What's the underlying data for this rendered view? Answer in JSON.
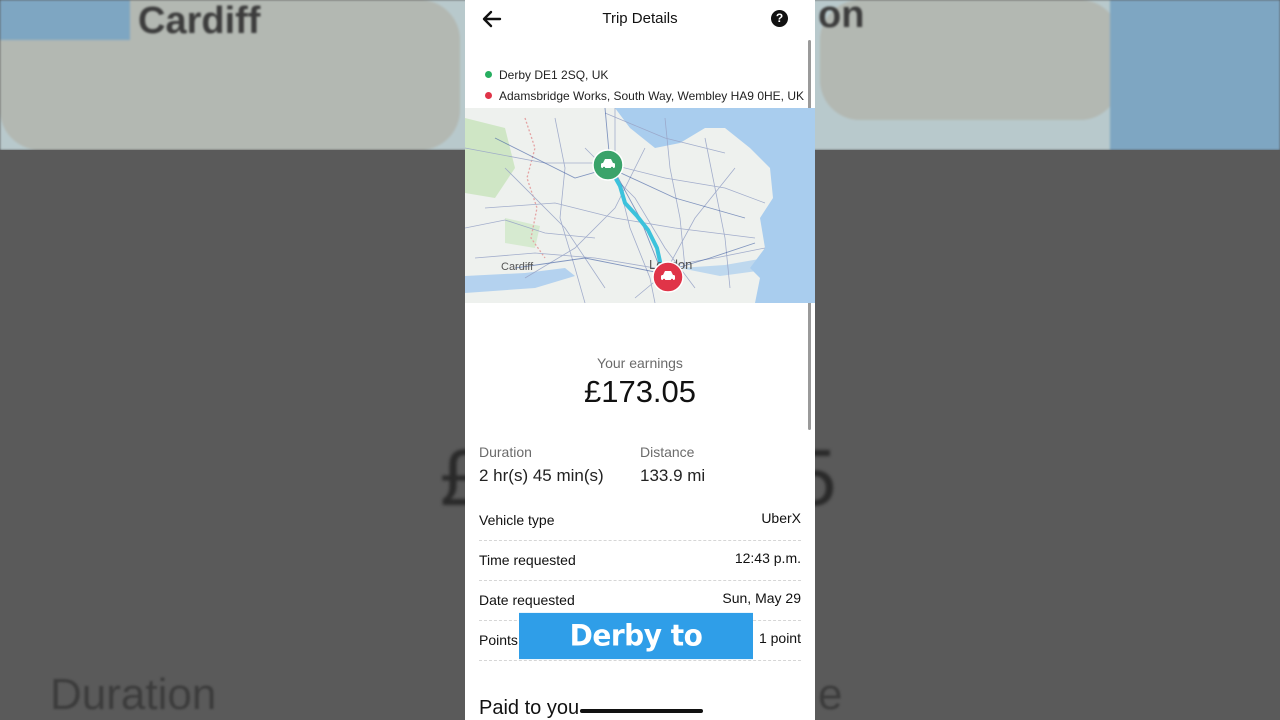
{
  "header": {
    "title": "Trip Details",
    "back_icon": "arrow-left-icon",
    "help_icon": "question-circle-icon",
    "help_glyph": "?"
  },
  "route": {
    "pickup": "Derby DE1 2SQ, UK",
    "dropoff": "Adamsbridge Works, South Way, Wembley HA9 0HE, UK",
    "pickup_color": "#27ae60",
    "dropoff_color": "#e03448"
  },
  "map": {
    "labels": {
      "cardiff": "Cardiff",
      "london": "London"
    },
    "route_color": "#3cc2dc",
    "pickup_marker_icon": "car-icon",
    "dropoff_marker_icon": "car-icon"
  },
  "earnings": {
    "label": "Your earnings",
    "value": "£173.05"
  },
  "stats": {
    "duration": {
      "label": "Duration",
      "value": "2 hr(s) 45 min(s)"
    },
    "distance": {
      "label": "Distance",
      "value": "133.9 mi"
    }
  },
  "details": [
    {
      "label": "Vehicle type",
      "value": "UberX"
    },
    {
      "label": "Time requested",
      "value": "12:43 p.m."
    },
    {
      "label": "Date requested",
      "value": "Sun, May 29"
    },
    {
      "label": "Points",
      "value": "1 point"
    }
  ],
  "paid_section": {
    "title": "Paid to you"
  },
  "caption": "Derby to wembley",
  "background": {
    "city_left": "Cardiff",
    "city_right": "on",
    "big_left": "£",
    "big_right": "5",
    "bottom_left": "Duration",
    "bottom_right": "e"
  }
}
